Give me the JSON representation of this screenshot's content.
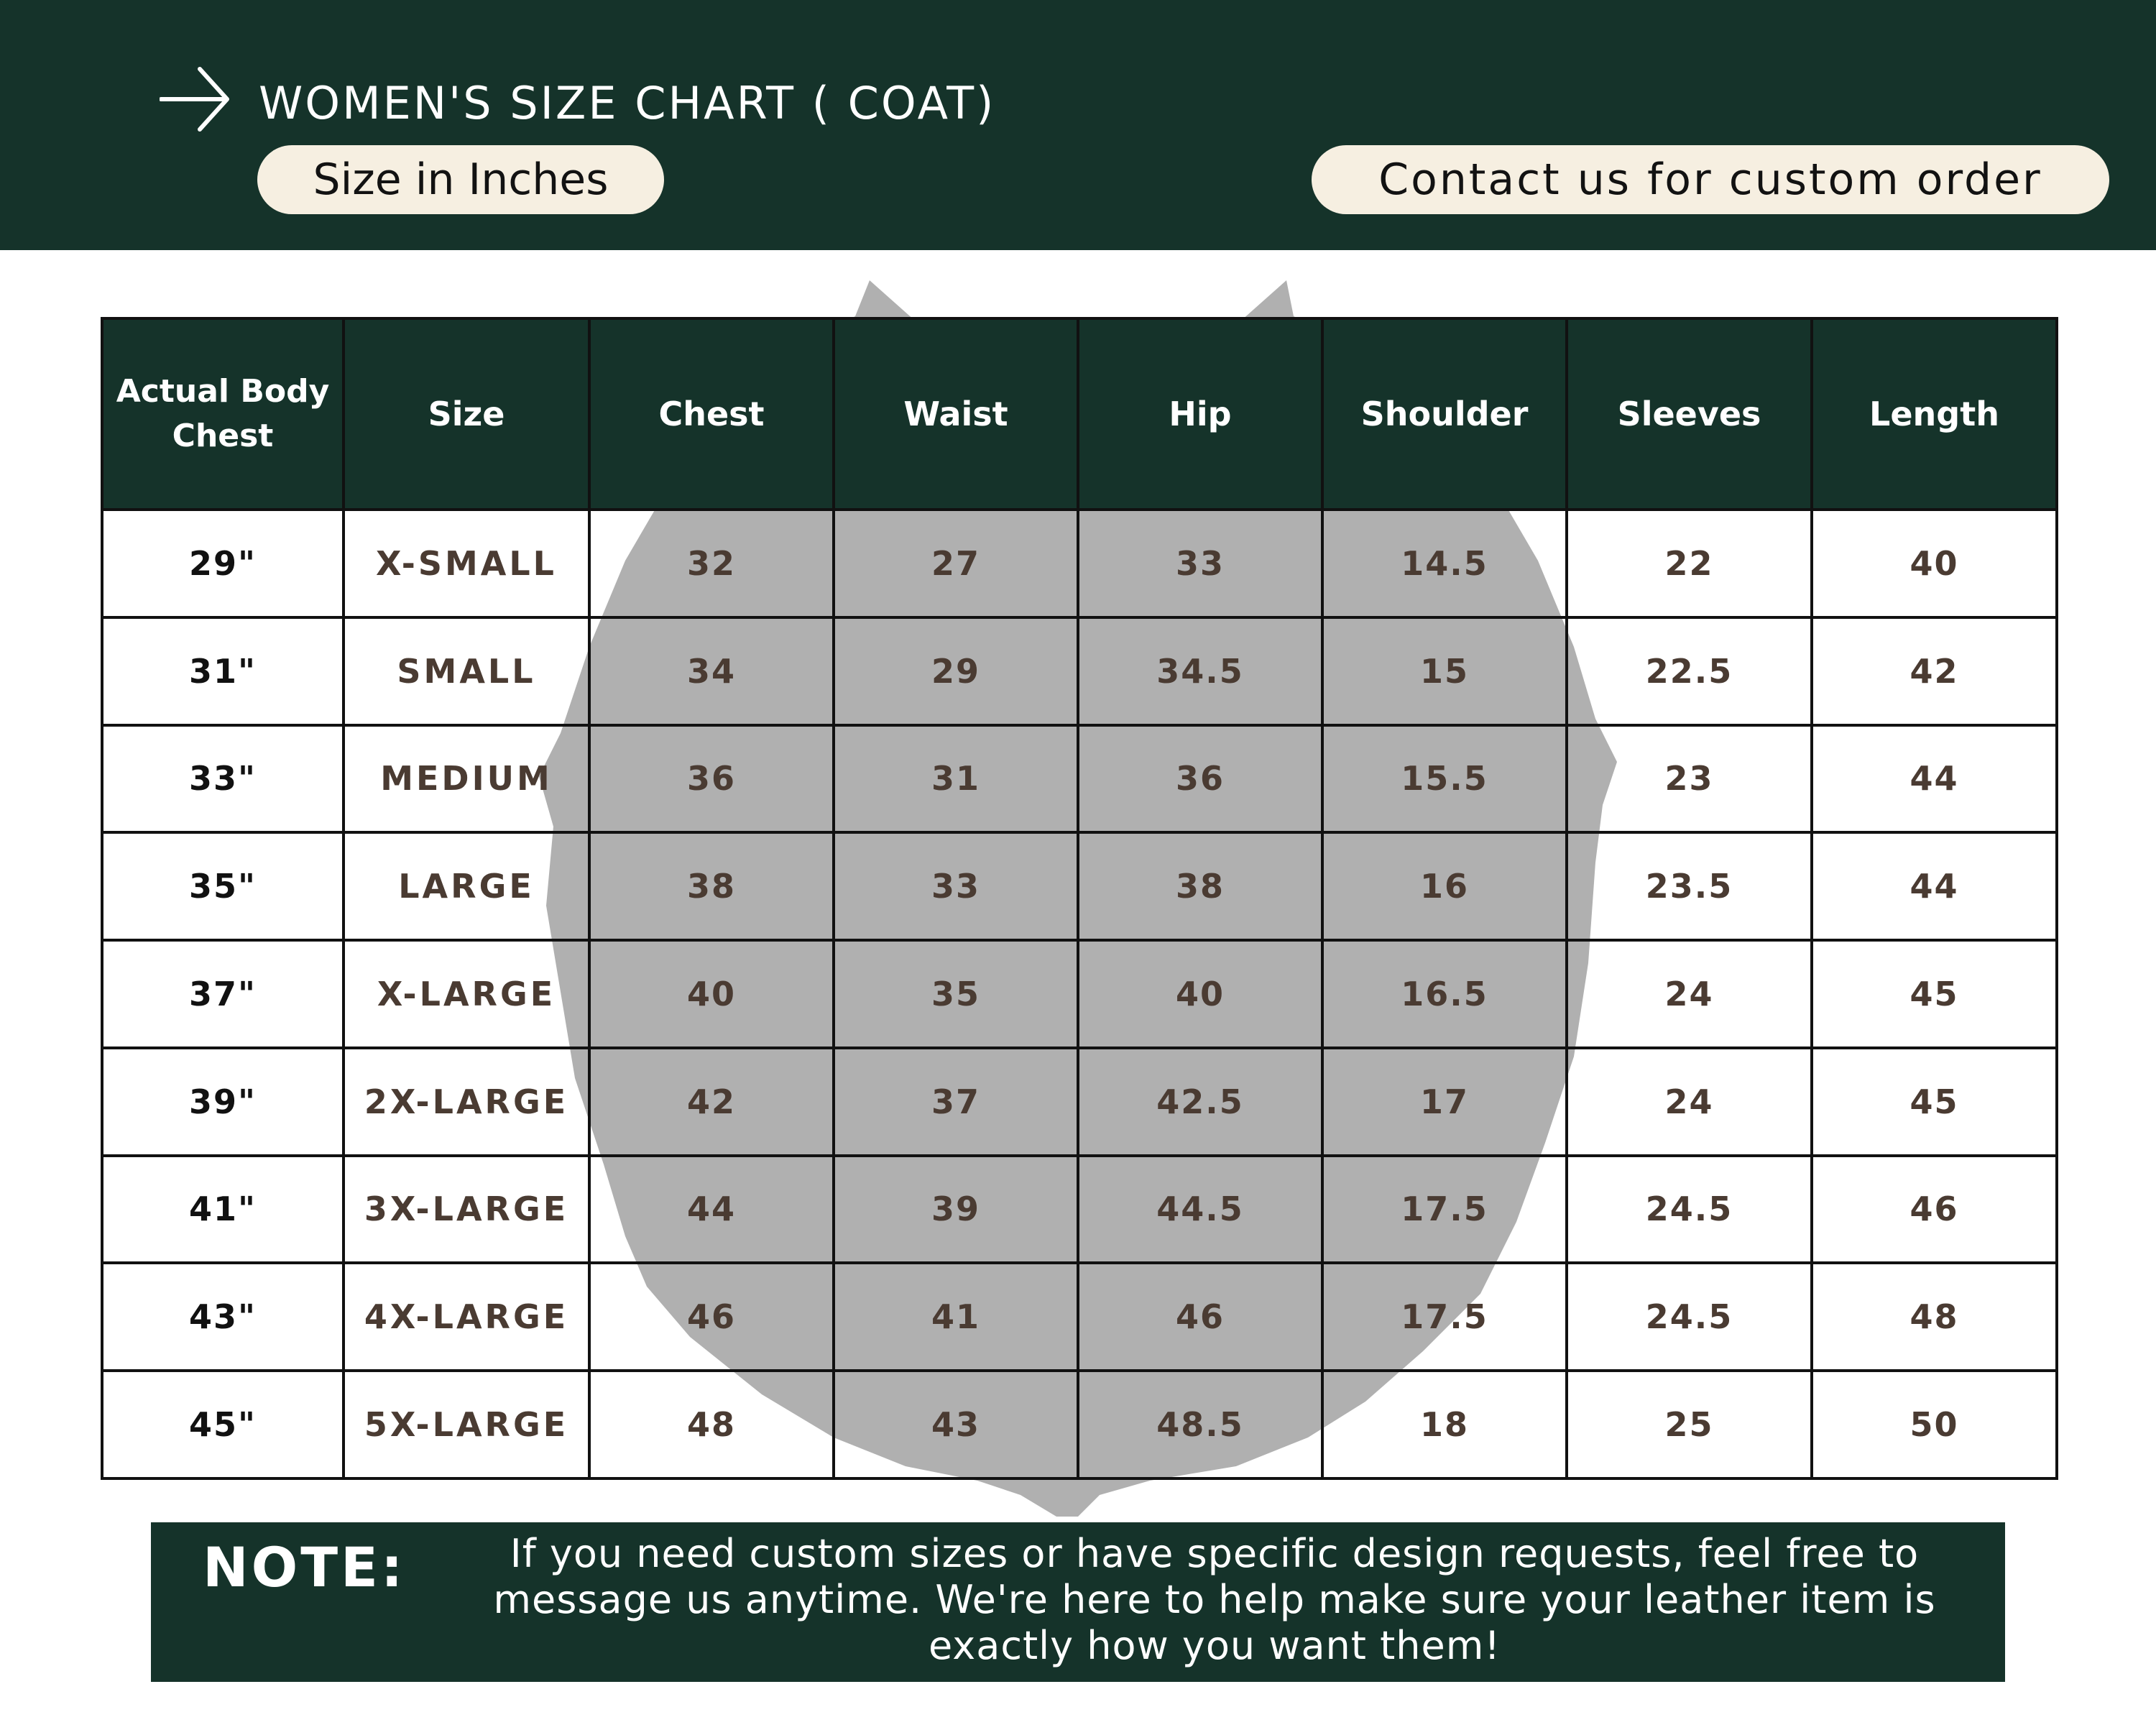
{
  "header": {
    "title": "WOMEN'S SIZE CHART ( COAT)",
    "units_label": "Size in Inches",
    "contact_label": "Contact us for custom order",
    "arrow_icon": "arrow-right-icon"
  },
  "colors": {
    "primary_green": "#15332a",
    "pill_cream": "#f6efe1",
    "value_brown": "#4a3b32",
    "silhouette_gray": "#b0b0b0"
  },
  "table": {
    "headers": [
      "Actual Body Chest",
      "Size",
      "Chest",
      "Waist",
      "Hip",
      "Shoulder",
      "Sleeves",
      "Length"
    ],
    "rows": [
      [
        "29\"",
        "X-SMALL",
        "32",
        "27",
        "33",
        "14.5",
        "22",
        "40"
      ],
      [
        "31\"",
        "SMALL",
        "34",
        "29",
        "34.5",
        "15",
        "22.5",
        "42"
      ],
      [
        "33\"",
        "MEDIUM",
        "36",
        "31",
        "36",
        "15.5",
        "23",
        "44"
      ],
      [
        "35\"",
        "LARGE",
        "38",
        "33",
        "38",
        "16",
        "23.5",
        "44"
      ],
      [
        "37\"",
        "X-LARGE",
        "40",
        "35",
        "40",
        "16.5",
        "24",
        "45"
      ],
      [
        "39\"",
        "2X-LARGE",
        "42",
        "37",
        "42.5",
        "17",
        "24",
        "45"
      ],
      [
        "41\"",
        "3X-LARGE",
        "44",
        "39",
        "44.5",
        "17.5",
        "24.5",
        "46"
      ],
      [
        "43\"",
        "4X-LARGE",
        "46",
        "41",
        "46",
        "17.5",
        "24.5",
        "48"
      ],
      [
        "45\"",
        "5X-LARGE",
        "48",
        "43",
        "48.5",
        "18",
        "25",
        "50"
      ]
    ]
  },
  "note": {
    "label": "NOTE:",
    "text": "If you need custom sizes or have specific design requests, feel free to message us anytime. We're here to help make sure your leather item is exactly how you want them!"
  }
}
